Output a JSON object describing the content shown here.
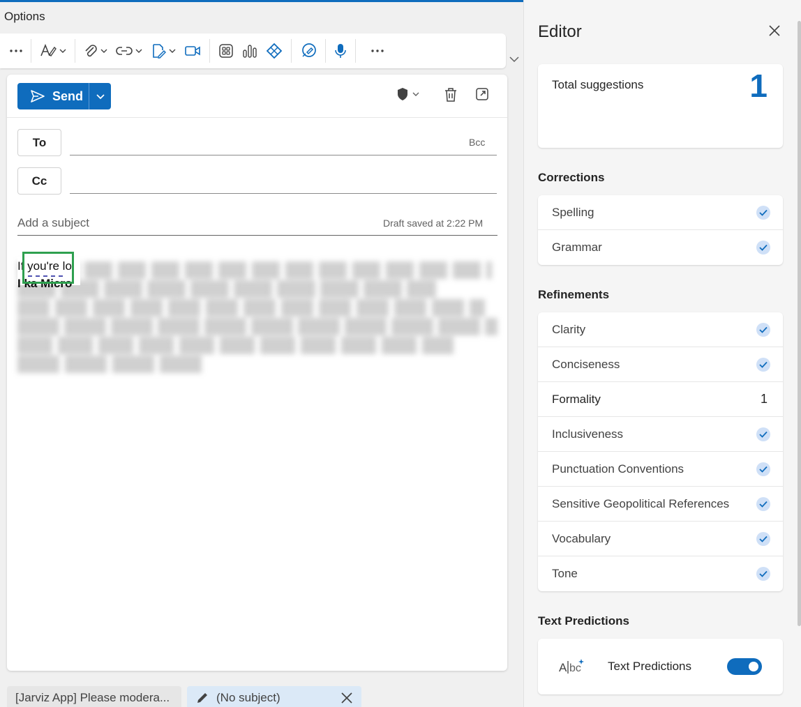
{
  "ribbon": {
    "tab_label": "Options"
  },
  "compose": {
    "send_label": "Send",
    "to_label": "To",
    "cc_label": "Cc",
    "bcc_label": "Bcc",
    "subject_placeholder": "Add a subject",
    "draft_status": "Draft saved at 2:22 PM",
    "body_visible_start": "If you're lo",
    "body_visible_line2": "I ka Micro"
  },
  "draft_tabs": [
    {
      "label": "[Jarviz App] Please modera..."
    },
    {
      "label": "(No subject)"
    }
  ],
  "editor": {
    "title": "Editor",
    "total_label": "Total suggestions",
    "total_count": "1",
    "corrections_heading": "Corrections",
    "corrections": [
      {
        "label": "Spelling",
        "status": "check"
      },
      {
        "label": "Grammar",
        "status": "check"
      }
    ],
    "refinements_heading": "Refinements",
    "refinements": [
      {
        "label": "Clarity",
        "status": "check"
      },
      {
        "label": "Conciseness",
        "status": "check"
      },
      {
        "label": "Formality",
        "count": "1"
      },
      {
        "label": "Inclusiveness",
        "status": "check"
      },
      {
        "label": "Punctuation Conventions",
        "status": "check"
      },
      {
        "label": "Sensitive Geopolitical References",
        "status": "check"
      },
      {
        "label": "Vocabulary",
        "status": "check"
      },
      {
        "label": "Tone",
        "status": "check"
      }
    ],
    "text_predictions_heading": "Text Predictions",
    "text_predictions_label": "Text Predictions",
    "text_predictions_enabled": true
  },
  "colors": {
    "accent": "#0f6cbd",
    "highlight_box": "#2ea04f"
  }
}
